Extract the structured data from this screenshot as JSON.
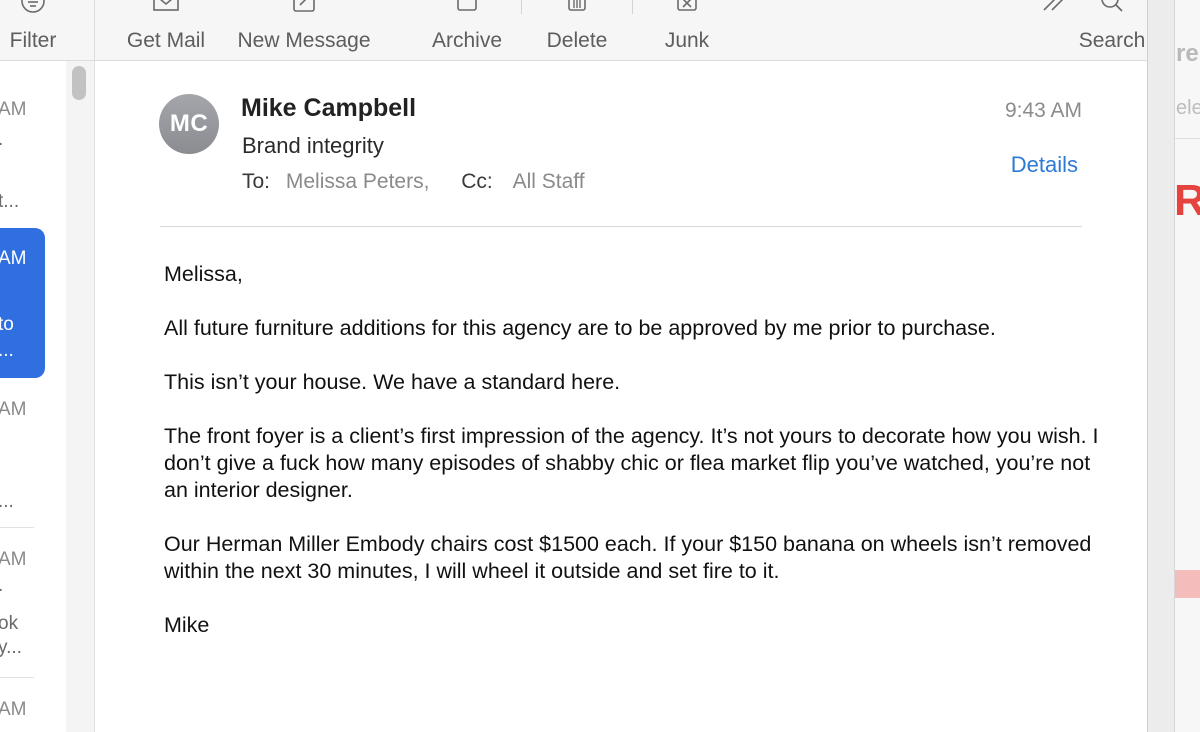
{
  "toolbar": {
    "filter_label": "Filter",
    "get_mail_label": "Get Mail",
    "new_message_label": "New Message",
    "archive_label": "Archive",
    "delete_label": "Delete",
    "junk_label": "Junk",
    "search_label": "Search"
  },
  "message_list": {
    "items": [
      {
        "time": "AM",
        "line2": ".",
        "line3": "t..."
      },
      {
        "time": "AM",
        "line2": "to",
        "line3": "..."
      },
      {
        "time": "AM",
        "line2": "...",
        "line3": ""
      },
      {
        "time": "AM",
        "line2": ".",
        "line3": "ok",
        "line4": "y..."
      },
      {
        "time": "AM"
      }
    ]
  },
  "email": {
    "avatar_initials": "MC",
    "sender": "Mike Campbell",
    "subject": "Brand integrity",
    "time": "9:43 AM",
    "details_label": "Details",
    "to_label": "To:",
    "to_value": "Melissa Peters,",
    "cc_label": "Cc:",
    "cc_value": "All Staff",
    "body": [
      "Melissa,",
      "All future furniture additions for this agency are to be approved by me prior to purchase.",
      "This isn’t your house. We have a standard here.",
      "The front foyer is a client’s first impression of the agency. It’s not yours to decorate how you wish. I don’t give a fuck how many episodes of shabby chic or flea market flip you’ve watched, you’re not an interior designer.",
      "Our Herman Miller Embody chairs cost $1500 each. If your $150 banana on wheels isn’t removed within the next 30 minutes, I will wheel it outside and set fire to it.",
      "Mike"
    ]
  },
  "right_window": {
    "text1": "re",
    "text2": "ele",
    "text3": "R"
  },
  "colors": {
    "accent": "#2f6fe0",
    "link": "#2d7ad6"
  }
}
